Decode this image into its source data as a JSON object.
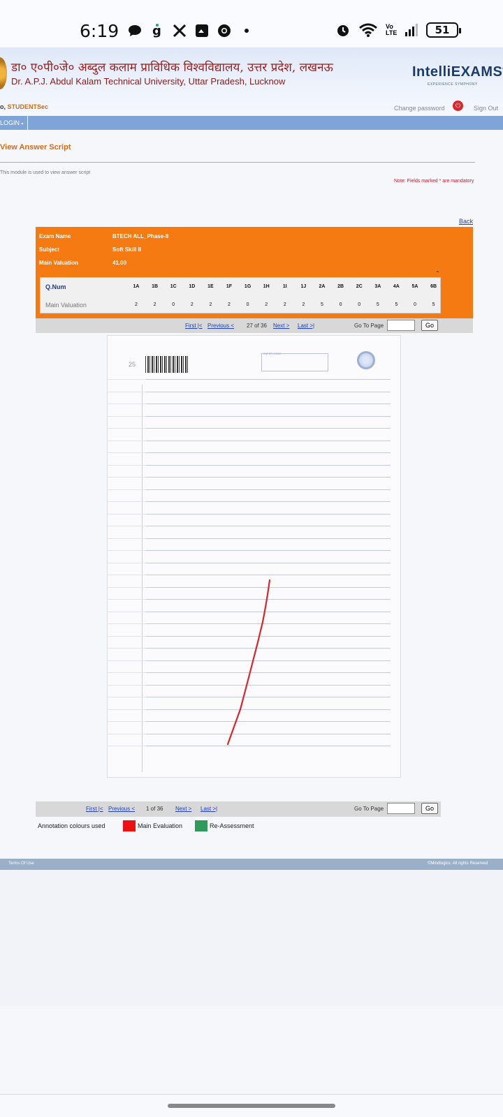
{
  "status_bar": {
    "time": "6:19",
    "left_icons": [
      "chat-bubble-icon",
      "g-app-icon",
      "x-icon",
      "gallery-icon",
      "chrome-icon",
      "dot-icon"
    ],
    "right_icons": [
      "alarm-icon",
      "wifi-icon",
      "volte-icon",
      "signal-icon"
    ],
    "volte_label": "Vo LTE",
    "battery": "51"
  },
  "header": {
    "hindi_title": "डा० ए०पी०जे० अब्दुल कलाम प्राविधिक विश्वविद्यालय, उत्तर प्रदेश, लखनऊ",
    "english_title": "Dr. A.P.J. Abdul Kalam Technical University, Uttar Pradesh, Lucknow",
    "brand": "IntelliEXAMS",
    "brand_reg": "®",
    "brand_tagline": "EXPERIENCE SYMPHONY",
    "welcome_prefix": "o,",
    "welcome_user": "STUDENTSec",
    "change_password": "Change password",
    "sign_out": "Sign Out"
  },
  "nav": {
    "login_menu": "LOGIN"
  },
  "page": {
    "title": "View Answer Script",
    "description": "This module is used to view answer script",
    "note": "Note: Fields marked * are mandatory",
    "back": "Back"
  },
  "exam_info": {
    "exam_name_label": "Exam Name",
    "exam_name": "BTECH ALL_Phase-II",
    "subject_label": "Subject",
    "subject": "Soft Skill II",
    "main_valuation_label": "Main Valuation",
    "main_valuation": "41.00",
    "collapse_caret": "⌃"
  },
  "marks_table": {
    "header_label": "Q.Num",
    "row_label": "Main Valuation",
    "questions": [
      "1A",
      "1B",
      "1C",
      "1D",
      "1E",
      "1F",
      "1G",
      "1H",
      "1I",
      "1J",
      "2A",
      "2B",
      "2C",
      "3A",
      "4A",
      "5A",
      "6B"
    ],
    "marks": [
      "2",
      "2",
      "0",
      "2",
      "2",
      "2",
      "0",
      "2",
      "2",
      "2",
      "5",
      "0",
      "0",
      "5",
      "5",
      "0",
      "5"
    ]
  },
  "pager_top": {
    "first": "First |<",
    "previous": "Previous <",
    "status": "27 of 36",
    "next": "Next >",
    "last": "Last >|",
    "goto_label": "Go To Page",
    "go_button": "Go"
  },
  "sheet": {
    "page_number": "25",
    "paper_code_label": "PAPER CODE",
    "annotation_color": "#d8262a"
  },
  "pager_bottom": {
    "first": "First |<",
    "previous": "Previous <",
    "status": "1 of 36",
    "next": "Next >",
    "last": "Last >|",
    "goto_label": "Go To Page",
    "go_button": "Go"
  },
  "legend": {
    "label": "Annotation colours used",
    "items": [
      {
        "name": "Main Evaluation",
        "color": "#ee1111"
      },
      {
        "name": "Re-Assessment",
        "color": "#2f9a5a"
      }
    ]
  },
  "footer": {
    "terms": "Terms Of Use",
    "copyright": "©Mindlogicx. All rights Reserved"
  },
  "colors": {
    "accent_orange": "#f57a12",
    "nav_blue": "#7ea4d9",
    "link_blue": "#1f3fbb"
  }
}
